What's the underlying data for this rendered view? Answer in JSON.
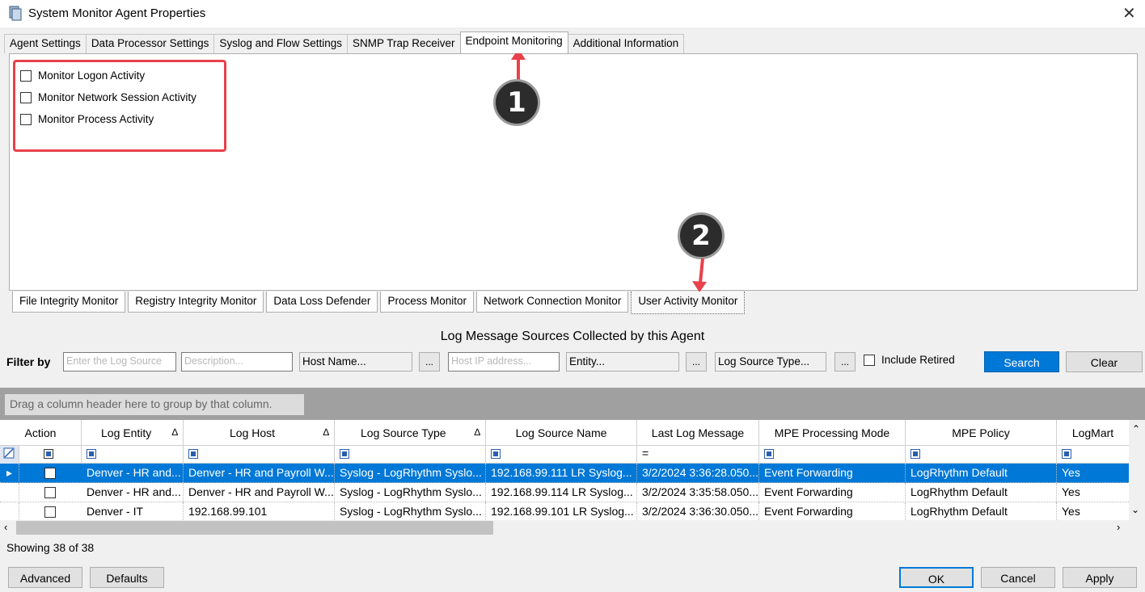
{
  "window": {
    "title": "System Monitor Agent Properties",
    "close": "✕"
  },
  "tabs": [
    "Agent Settings",
    "Data Processor Settings",
    "Syslog and Flow Settings",
    "SNMP Trap Receiver",
    "Endpoint Monitoring",
    "Additional Information"
  ],
  "active_tab": "Endpoint Monitoring",
  "endpoint": {
    "checkboxes": [
      {
        "label": "Monitor Logon Activity",
        "checked": false
      },
      {
        "label": "Monitor Network Session Activity",
        "checked": false
      },
      {
        "label": "Monitor Process Activity",
        "checked": false
      }
    ]
  },
  "subtabs": [
    "File Integrity Monitor",
    "Registry Integrity Monitor",
    "Data Loss Defender",
    "Process Monitor",
    "Network Connection Monitor",
    "User Activity Monitor"
  ],
  "active_subtab": "User Activity Monitor",
  "annotations": {
    "badge1": "1",
    "badge2": "2",
    "color": "#e8414b"
  },
  "log_sources": {
    "title": "Log Message Sources Collected by this Agent",
    "filter_label": "Filter by",
    "filters": {
      "log_source_placeholder": "Enter the Log Source",
      "description_placeholder": "Description...",
      "host_name": "Host Name...",
      "host_ip_placeholder": "Host IP address...",
      "entity": "Entity...",
      "log_source_type": "Log Source Type...",
      "dots": "...",
      "include_retired": "Include Retired"
    },
    "search_button": "Search",
    "clear_button": "Clear",
    "group_hint": "Drag a column header here to group by that column.",
    "columns": [
      "Action",
      "Log Entity",
      "Log Host",
      "Log Source Type",
      "Log Source Name",
      "Last Log Message",
      "MPE Processing Mode",
      "MPE Policy",
      "LogMart"
    ],
    "sort_indicator": "∆",
    "equals_filter": "=",
    "rows": [
      [
        "",
        "Denver - HR and...",
        "Denver - HR and Payroll W...",
        "Syslog - LogRhythm Syslo...",
        "192.168.99.111 LR Syslog...",
        "3/2/2024 3:36:28.050...",
        "Event Forwarding",
        "LogRhythm Default",
        "Yes"
      ],
      [
        "",
        "Denver - HR and...",
        "Denver - HR and Payroll W...",
        "Syslog - LogRhythm Syslo...",
        "192.168.99.114 LR Syslog...",
        "3/2/2024 3:35:58.050...",
        "Event Forwarding",
        "LogRhythm Default",
        "Yes"
      ],
      [
        "",
        "Denver - IT",
        "192.168.99.101",
        "Syslog - LogRhythm Syslo...",
        "192.168.99.101 LR Syslog...",
        "3/2/2024 3:36:30.050...",
        "Event Forwarding",
        "LogRhythm Default",
        "Yes"
      ]
    ],
    "selected_row": 0,
    "status": "Showing 38 of 38"
  },
  "footer": {
    "advanced": "Advanced",
    "defaults": "Defaults",
    "ok": "OK",
    "cancel": "Cancel",
    "apply": "Apply"
  },
  "colors": {
    "accent": "#0078d7",
    "annotation_red": "#e8414b",
    "group_bar": "#a0a0a0"
  }
}
